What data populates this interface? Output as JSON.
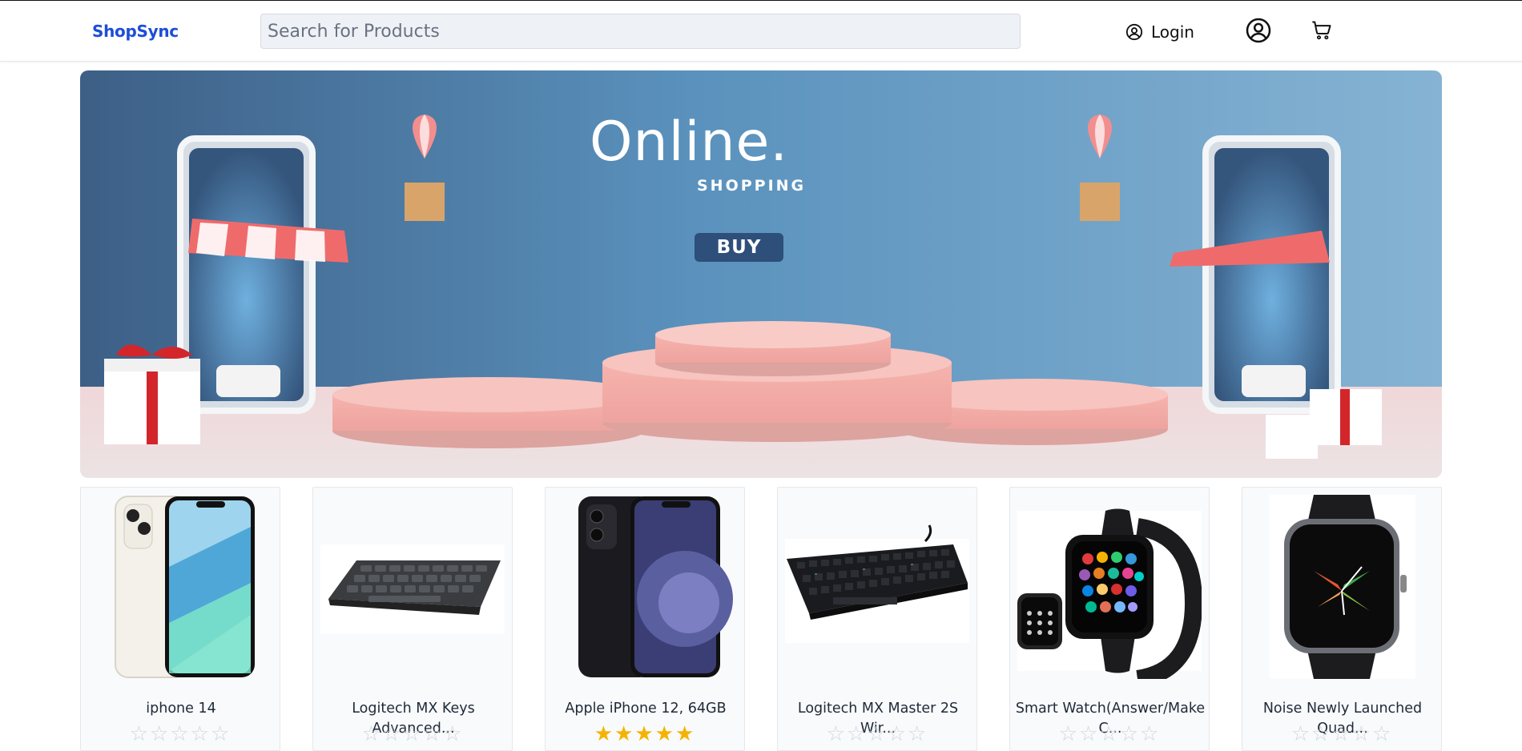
{
  "header": {
    "brand": "ShopSync",
    "search_placeholder": "Search for Products",
    "login_label": "Login"
  },
  "banner": {
    "headline": "Online.",
    "subline": "SHOPPING",
    "cta": "BUY"
  },
  "products": [
    {
      "name": "iphone 14",
      "rating": 0,
      "image": "white-iphone"
    },
    {
      "name": "Logitech MX Keys Advanced...",
      "rating": 0,
      "image": "compact-keyboard"
    },
    {
      "name": "Apple iPhone 12, 64GB",
      "rating": 5,
      "image": "black-iphone"
    },
    {
      "name": "Logitech MX Master 2S Wir...",
      "rating": 0,
      "image": "mechanical-keyboard"
    },
    {
      "name": "Smart Watch(Answer/Make C...",
      "rating": 0,
      "image": "smartwatch"
    },
    {
      "name": "Noise Newly Launched Quad...",
      "rating": 0,
      "image": "noise-smartwatch"
    }
  ],
  "colors": {
    "brand": "#1d4ed8",
    "star_filled": "#f5b301",
    "star_empty": "#d1d5db",
    "banner_cta": "#2d4f7a"
  }
}
